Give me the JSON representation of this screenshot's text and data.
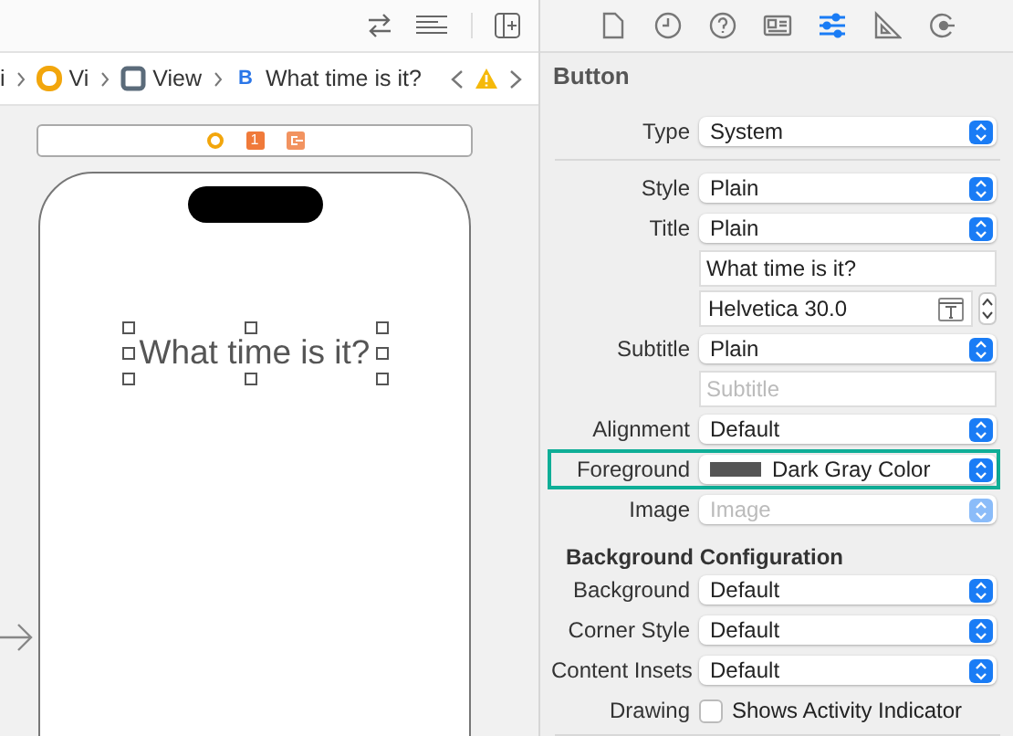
{
  "editor": {
    "breadcrumb": [
      {
        "kind": "scene",
        "label": "i"
      },
      {
        "kind": "controller",
        "label": "Vi"
      },
      {
        "kind": "view",
        "label": "View"
      },
      {
        "kind": "button",
        "badge": "B",
        "label": "What time is it?"
      }
    ],
    "scene_bar": {
      "badge": "1"
    },
    "canvas": {
      "button_title": "What time is it?"
    }
  },
  "inspector": {
    "tabs": [
      {
        "selected": false
      },
      {
        "selected": false
      },
      {
        "selected": false
      },
      {
        "selected": false
      },
      {
        "selected": true
      },
      {
        "selected": false
      },
      {
        "selected": false
      }
    ],
    "title": "Button",
    "rows": [
      {
        "kind": "popup",
        "label": "Type",
        "value": "System",
        "disabled": false,
        "highlighted": false
      },
      {
        "kind": "divider"
      },
      {
        "kind": "popup",
        "label": "Style",
        "value": "Plain",
        "disabled": false,
        "highlighted": false
      },
      {
        "kind": "popup",
        "label": "Title",
        "value": "Plain",
        "disabled": false,
        "highlighted": false
      },
      {
        "kind": "text",
        "value": "What time is it?",
        "highlighted": false
      },
      {
        "kind": "font",
        "value": "Helvetica 30.0",
        "highlighted": false
      },
      {
        "kind": "popup",
        "label": "Subtitle",
        "value": "Plain",
        "disabled": false,
        "highlighted": false
      },
      {
        "kind": "text",
        "placeholder": "Subtitle",
        "highlighted": false
      },
      {
        "kind": "popup",
        "label": "Alignment",
        "value": "Default",
        "disabled": false,
        "highlighted": false
      },
      {
        "kind": "color",
        "label": "Foreground",
        "value": "Dark Gray Color",
        "color": "#555555",
        "disabled": false,
        "highlighted": true
      },
      {
        "kind": "popup",
        "label": "Image",
        "placeholder": "Image",
        "disabled": true,
        "highlighted": false
      },
      {
        "kind": "heading",
        "label": "Background Configuration"
      },
      {
        "kind": "popup",
        "label": "Background",
        "value": "Default",
        "disabled": false,
        "highlighted": false
      },
      {
        "kind": "popup",
        "label": "Corner Style",
        "value": "Default",
        "disabled": false,
        "highlighted": false
      },
      {
        "kind": "popup",
        "label": "Content Insets",
        "value": "Default",
        "disabled": false,
        "highlighted": false
      },
      {
        "kind": "checkbox",
        "label": "Drawing",
        "text": "Shows Activity Indicator",
        "checked": false
      }
    ]
  }
}
